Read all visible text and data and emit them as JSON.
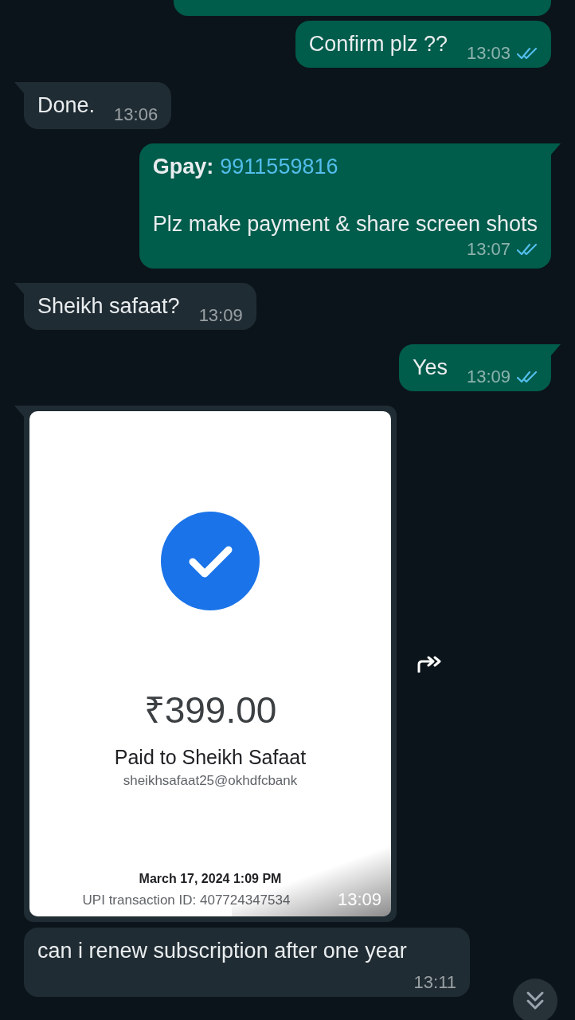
{
  "messages": [
    {
      "kind": "cut_off",
      "outgoing": true
    },
    {
      "kind": "text",
      "outgoing": true,
      "text": "Confirm plz ??",
      "time": "13:03",
      "read": true
    },
    {
      "kind": "text",
      "outgoing": false,
      "text": "Done.",
      "time": "13:06"
    },
    {
      "kind": "info",
      "outgoing": true,
      "label": "Gpay:",
      "phone": "9911559816",
      "text": "Plz make payment & share screen shots",
      "time": "13:07",
      "read": true
    },
    {
      "kind": "text",
      "outgoing": false,
      "text": "Sheikh safaat?",
      "time": "13:09"
    },
    {
      "kind": "text",
      "outgoing": true,
      "text": "Yes",
      "time": "13:09",
      "read": true
    },
    {
      "kind": "image",
      "outgoing": false,
      "time": "13:09",
      "receipt": {
        "amount": "₹399.00",
        "paid_to": "Paid to Sheikh Safaat",
        "upi_id": "sheikhsafaat25@okhdfcbank",
        "date": "March 17, 2024 1:09 PM",
        "transaction": "UPI transaction ID: 407724347534"
      }
    },
    {
      "kind": "text",
      "outgoing": false,
      "text": "can i renew subscription after one year",
      "time": "13:11"
    }
  ]
}
